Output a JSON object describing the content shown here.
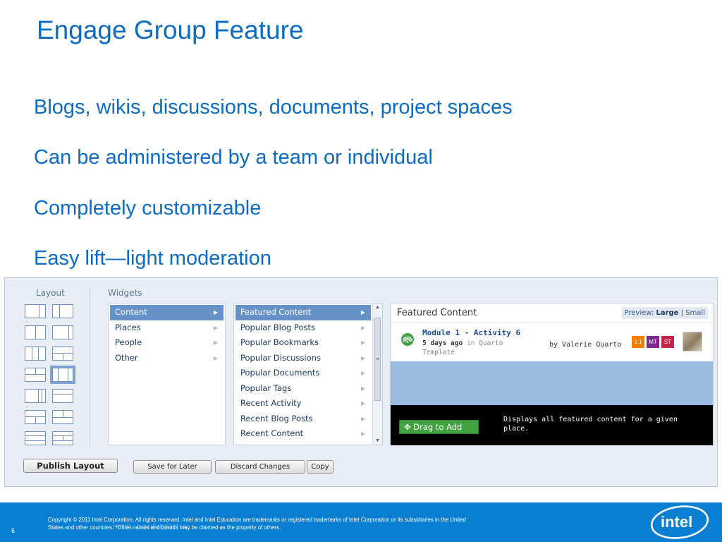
{
  "slide": {
    "title": "Engage Group Feature",
    "bullets": [
      "Blogs, wikis, discussions, documents, project spaces",
      "Can be administered by a team or individual",
      "Completely customizable",
      "Easy lift—light moderation"
    ]
  },
  "editor": {
    "layout_label": "Layout",
    "widgets_label": "Widgets",
    "categories": [
      {
        "label": "Content",
        "selected": true
      },
      {
        "label": "Places",
        "selected": false
      },
      {
        "label": "People",
        "selected": false
      },
      {
        "label": "Other",
        "selected": false
      }
    ],
    "widgets": [
      {
        "label": "Featured Content",
        "selected": true
      },
      {
        "label": "Popular Blog Posts",
        "selected": false
      },
      {
        "label": "Popular Bookmarks",
        "selected": false
      },
      {
        "label": "Popular Discussions",
        "selected": false
      },
      {
        "label": "Popular Documents",
        "selected": false
      },
      {
        "label": "Popular Tags",
        "selected": false
      },
      {
        "label": "Recent Activity",
        "selected": false
      },
      {
        "label": "Recent Blog Posts",
        "selected": false
      },
      {
        "label": "Recent Content",
        "selected": false
      }
    ],
    "preview": {
      "title": "Featured Content",
      "toggle_prefix": "Preview:",
      "toggle_large": "Large",
      "toggle_sep": "|",
      "toggle_small": "Small",
      "item_title": "Module 1 - Activity 6",
      "item_age": "5 days ago",
      "item_in": "in",
      "item_place_1": "Quarto",
      "item_place_2": "Template",
      "item_author": "by Valerie Quarto",
      "badges": [
        "1:1",
        "MT",
        "ST"
      ],
      "badge_colors": [
        "#f07d00",
        "#7a2a8f",
        "#c4244a"
      ],
      "drag_label": "Drag to Add",
      "description": [
        "Displays all featured content for a given",
        "place."
      ]
    },
    "buttons": {
      "publish": "Publish Layout",
      "save": "Save for Later",
      "discard": "Discard Changes",
      "copy": "Copy"
    }
  },
  "footer": {
    "page_number": "6",
    "copyright_line1": "Copyright © 2011 Intel Corporation. All rights reserved. Intel and Intel Education are trademarks or registered trademarks of Intel Corporation or its subsidiaries in the United",
    "copyright_line2": "States and other countries. *Other names and brands may be claimed as the property of others.",
    "confidential": "INTEL CONFIDENTIAL",
    "logo_text": "intel"
  },
  "colors": {
    "accent": "#0a6cc4",
    "footer_bg": "#0a7fd1",
    "selected": "#6792c8",
    "drag_green": "#3fa33f"
  }
}
